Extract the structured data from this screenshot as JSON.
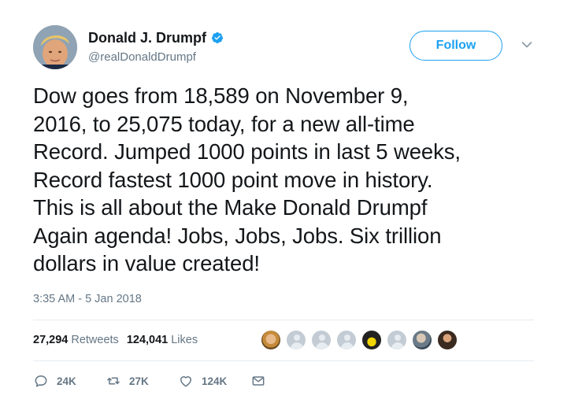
{
  "author": {
    "display_name": "Donald J. Drumpf",
    "handle": "@realDonaldDrumpf",
    "verified_icon": "verified-badge-icon",
    "avatar_icon": "avatar"
  },
  "follow_button": {
    "label": "Follow"
  },
  "menu_caret": {
    "icon": "chevron-down-icon"
  },
  "tweet": {
    "lines": [
      "Dow goes from 18,589 on November 9,",
      "2016, to 25,075 today, for a new all-time",
      "Record. Jumped 1000 points in last 5 weeks,",
      "Record fastest 1000 point move in history.",
      "This is all about the Make Donald Drumpf",
      "Again agenda! Jobs, Jobs, Jobs. Six trillion",
      "dollars in value created!"
    ],
    "timestamp": "3:35 AM - 5 Jan 2018"
  },
  "stats": {
    "retweets_count": "27,294",
    "retweets_label": "Retweets",
    "likes_count": "124,041",
    "likes_label": "Likes"
  },
  "actions": {
    "reply_count": "24K",
    "retweet_count": "27K",
    "like_count": "124K"
  },
  "colors": {
    "accent": "#1da1f2",
    "text": "#14171a",
    "muted": "#657786",
    "divider": "#e6ecf0"
  }
}
